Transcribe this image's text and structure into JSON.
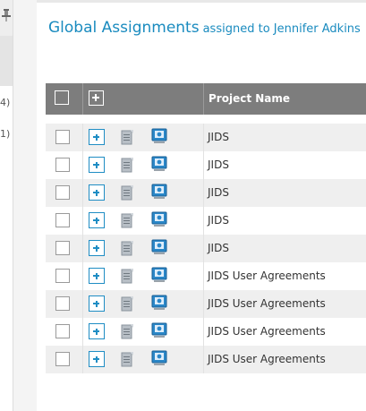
{
  "sidebar": {
    "counts": [
      "4)",
      "1)"
    ]
  },
  "header": {
    "title": "Global Assignments",
    "subtitle": "assigned to Jennifer Adkins"
  },
  "table": {
    "column_headers": [
      "Project Name"
    ],
    "rows": [
      {
        "project_name": "JIDS"
      },
      {
        "project_name": "JIDS"
      },
      {
        "project_name": "JIDS"
      },
      {
        "project_name": "JIDS"
      },
      {
        "project_name": "JIDS"
      },
      {
        "project_name": "JIDS User Agreements"
      },
      {
        "project_name": "JIDS User Agreements"
      },
      {
        "project_name": "JIDS User Agreements"
      },
      {
        "project_name": "JIDS User Agreements"
      }
    ]
  },
  "icons": {
    "row_icons": [
      "expand-icon",
      "document-icon",
      "budget-icon"
    ],
    "pin": "pin-icon"
  },
  "colors": {
    "accent": "#1a8bbf",
    "header_bg": "#7d7d7d",
    "row_alt": "#efefef"
  }
}
